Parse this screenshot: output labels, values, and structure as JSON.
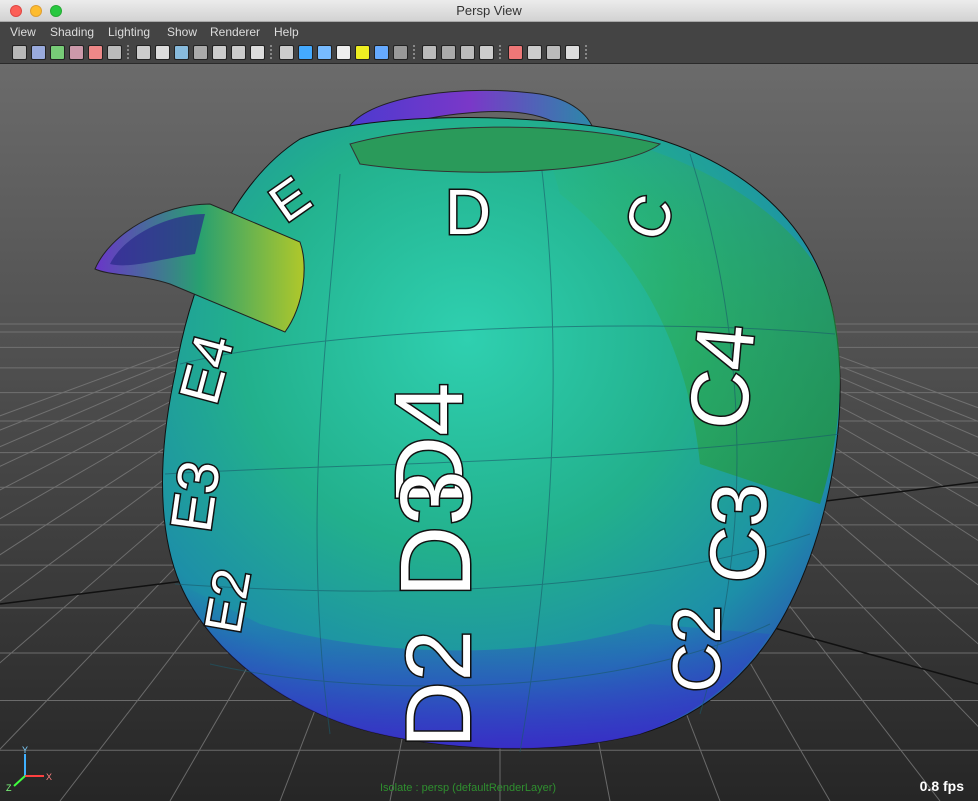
{
  "window": {
    "title": "Persp View"
  },
  "menu": [
    "View",
    "Shading",
    "Lighting",
    "Show",
    "Renderer",
    "Help"
  ],
  "toolbar": {
    "icons": [
      "camera-attributes-icon",
      "bookmark-icon",
      "image-plane-icon",
      "2d-pan-icon",
      "grease-pencil-icon",
      "grid-icon",
      "wireframe-icon",
      "smooth-shade-icon",
      "default-material-icon",
      "bounding-box-icon",
      "xray-icon",
      "backface-icon",
      "textured-icon",
      "cube-wire-icon",
      "cube-shaded-icon",
      "cube-smooth-icon",
      "checker-icon",
      "light-icon",
      "sphere-icon",
      "sphere-dark-icon",
      "shadow-icon",
      "ao-icon",
      "motion-blur-icon",
      "dof-icon",
      "isolate-icon",
      "cube-small-icon",
      "cube-outline-icon",
      "share-icon"
    ]
  },
  "viewport": {
    "bg_top": "#6b6b6b",
    "bg_bottom": "#262626",
    "labels": [
      "E",
      "D",
      "C",
      "E4",
      "D4",
      "C4",
      "E3",
      "D3",
      "C3",
      "E2",
      "D2",
      "C2"
    ],
    "status_text": "Isolate : persp (defaultRenderLayer)",
    "fps": "0.8 fps",
    "axis_labels": [
      "Y",
      "Z",
      "X"
    ]
  }
}
